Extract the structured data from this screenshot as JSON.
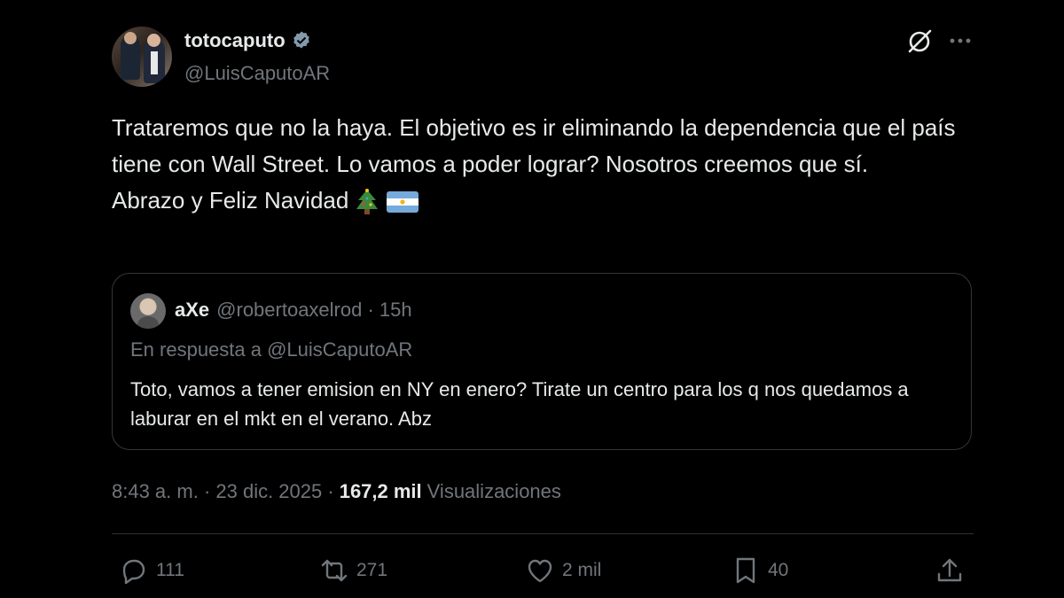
{
  "author": {
    "display_name": "totocaputo",
    "handle": "@LuisCaputoAR",
    "verified": true,
    "verified_color": "#829aab"
  },
  "tweet": {
    "lines": [
      "Trataremos que no la haya. El objetivo es ir eliminando la dependencia que el país tiene con Wall Street. Lo vamos a poder lograr? Nosotros creemos que sí.",
      "Abrazo y Feliz Navidad"
    ],
    "emojis": [
      "christmas-tree-icon",
      "argentina-flag-icon"
    ]
  },
  "quote": {
    "display_name": "aXe",
    "handle_time": "@robertoaxelrod · 15h",
    "reply_to": "En respuesta a @LuisCaputoAR",
    "text": "Toto, vamos a tener emision en NY en enero? Tirate un centro para los q nos quedamos a laburar en el mkt en el verano. Abz"
  },
  "meta": {
    "datetime": "8:43 a. m. · 23 dic. 2025 ·",
    "views_count": "167,2 mil",
    "views_label": "Visualizaciones"
  },
  "actions": {
    "reply_count": "111",
    "retweet_count": "271",
    "like_count": "2 mil",
    "bookmark_count": "40"
  },
  "icons": [
    "grok-icon",
    "more-icon",
    "reply-icon",
    "retweet-icon",
    "like-icon",
    "bookmark-icon",
    "share-icon"
  ],
  "colors": {
    "background": "#000000",
    "text": "#e7e9ea",
    "muted": "#71767b",
    "border": "#333639"
  }
}
